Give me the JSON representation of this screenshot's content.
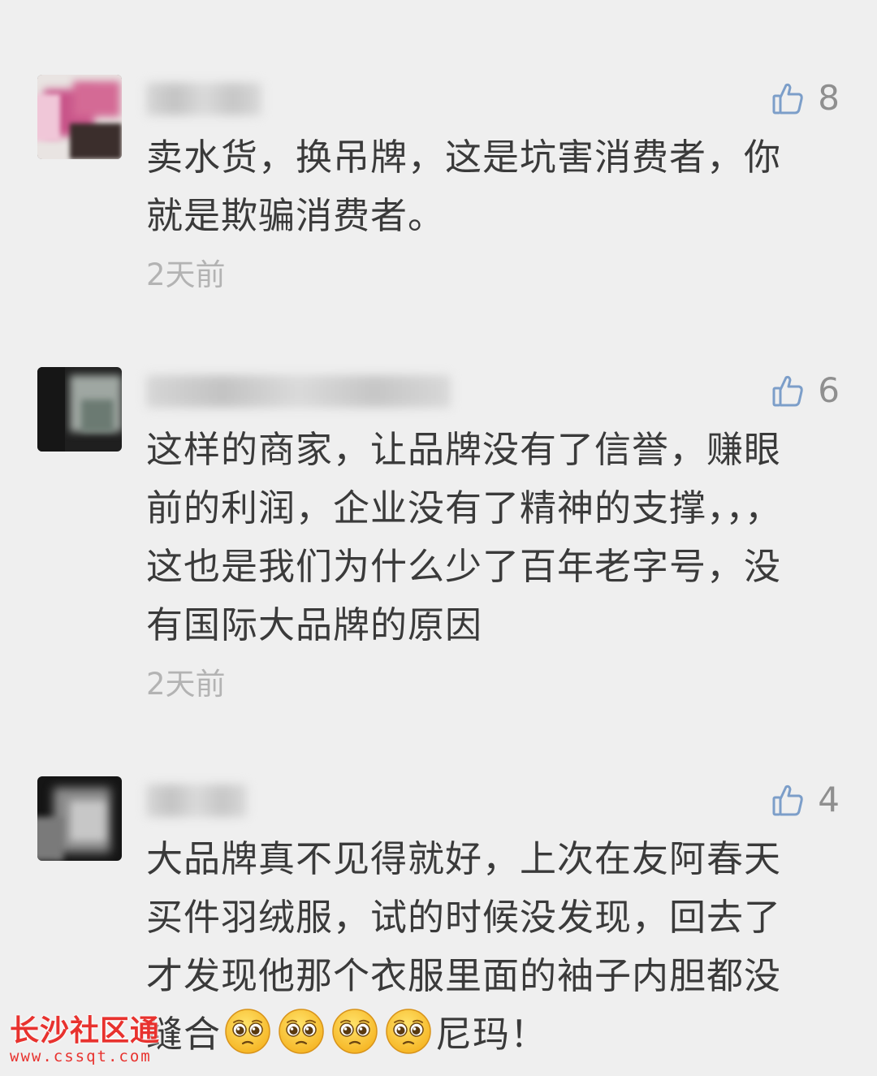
{
  "colors": {
    "background": "#efefef",
    "text": "#3a3a3a",
    "muted": "#b3b3b3",
    "like": "#8f8f8f",
    "watermark": "#e8322e"
  },
  "comments": [
    {
      "like_icon": "thumbs-up-icon",
      "likes": "8",
      "text": "卖水货，换吊牌，这是坑害消费者，你就是欺骗消费者。",
      "time": "2天前"
    },
    {
      "like_icon": "thumbs-up-icon",
      "likes": "6",
      "text": "这样的商家，让品牌没有了信誉，赚眼前的利润，企业没有了精神的支撑，，，这也是我们为什么少了百年老字号，没有国际大品牌的原因",
      "time": "2天前"
    },
    {
      "like_icon": "thumbs-up-icon",
      "likes": "4",
      "text_before_emoji": "大品牌真不见得就好，上次在友阿春天买件羽绒服，试的时候没发现，回去了才发现他那个衣服里面的袖子内胆都没缝合",
      "emoji_icon": "pleading-face-emoji",
      "emoji_count": 4,
      "text_after_emoji": "尼玛！"
    }
  ],
  "watermark": {
    "title": "长沙社区通",
    "url": "www.cssqt.com"
  }
}
